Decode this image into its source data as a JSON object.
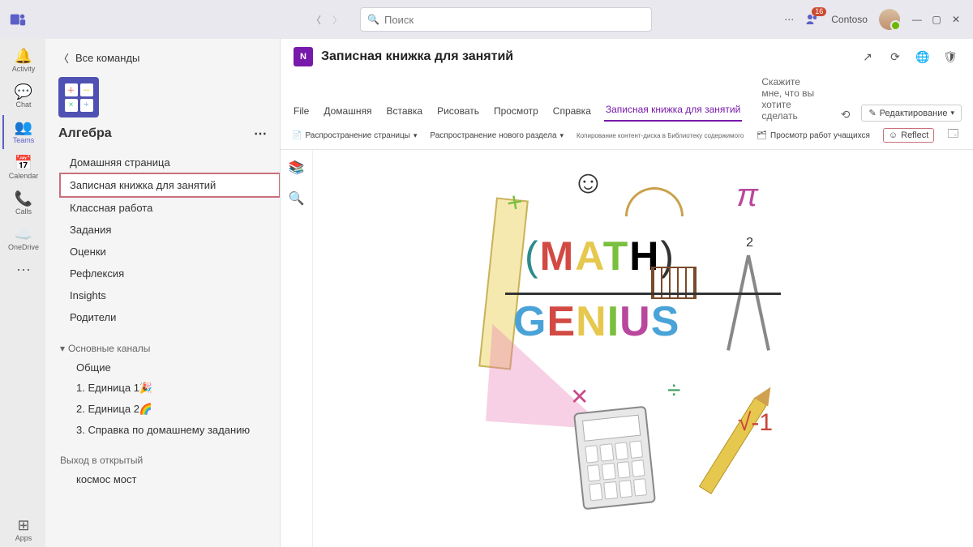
{
  "titlebar": {
    "search_placeholder": "Поиск",
    "org": "Contoso",
    "badge": "16"
  },
  "apprail": {
    "items": [
      {
        "label": "Activity",
        "icon": "bell"
      },
      {
        "label": "Chat",
        "icon": "chat"
      },
      {
        "label": "Teams",
        "icon": "teams",
        "active": true
      },
      {
        "label": "Calendar",
        "icon": "calendar"
      },
      {
        "label": "Calls",
        "icon": "calls"
      },
      {
        "label": "OneDrive",
        "icon": "cloud"
      },
      {
        "label": "",
        "icon": "more"
      }
    ],
    "apps_label": "Apps"
  },
  "teamsidebar": {
    "back": "Все команды",
    "team_name": "Алгебра",
    "tabs": [
      "Домашняя страница",
      "Записная книжка для занятий",
      "Классная работа",
      "Задания",
      "Оценки",
      "Рефлексия",
      "Insights",
      "Родители"
    ],
    "selected_tab_index": 1,
    "channels_header": "Основные каналы",
    "channels": [
      "Общие",
      "1. Единица 1🎉",
      "2. Единица 2🌈",
      "3. Справка по домашнему заданию"
    ],
    "group2_label": "Выход в открытый",
    "group2_items": [
      "космос мост"
    ]
  },
  "content": {
    "title": "Записная книжка для занятий",
    "ribbon_tabs": [
      "File",
      "Домашняя",
      "Вставка",
      "Рисовать",
      "Просмотр",
      "Справка",
      "Записная книжка для занятий"
    ],
    "ribbon_active_index": 6,
    "tell_me": "Скажите мне, что вы хотите сделать",
    "edit_label": "Редактирование",
    "toolbar": {
      "distribute_page": "Распространение страницы",
      "distribute_section": "Распространение нового раздела",
      "copy_lib": "Копирование контент-диска в Библиотеку содержимого",
      "review_work": "Просмотр работ учащихся",
      "reflect": "Reflect"
    }
  }
}
